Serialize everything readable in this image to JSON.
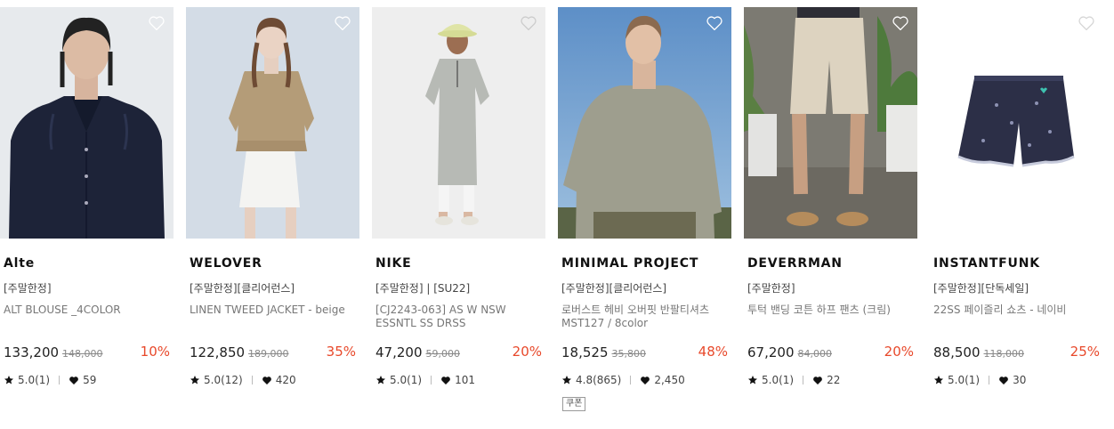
{
  "products": [
    {
      "brand": "Alte",
      "tag": "[주말한정]",
      "name": "ALT BLOUSE _4COLOR",
      "price": "133,200",
      "original_price": "148,000",
      "discount": "10%",
      "rating": "5.0(1)",
      "likes": "59"
    },
    {
      "brand": "WELOVER",
      "tag": "[주말한정][클리어런스]",
      "name": "LINEN TWEED JACKET - beige",
      "price": "122,850",
      "original_price": "189,000",
      "discount": "35%",
      "rating": "5.0(12)",
      "likes": "420"
    },
    {
      "brand": "NIKE",
      "tag": "[주말한정] | [SU22]",
      "name": "[CJ2243-063] AS W NSW ESSNTL SS DRSS",
      "price": "47,200",
      "original_price": "59,000",
      "discount": "20%",
      "rating": "5.0(1)",
      "likes": "101"
    },
    {
      "brand": "MINIMAL PROJECT",
      "tag": "[주말한정][클리어런스]",
      "name": "로버스트 헤비 오버핏 반팔티셔츠 MST127 / 8color",
      "price": "18,525",
      "original_price": "35,800",
      "discount": "48%",
      "rating": "4.8(865)",
      "likes": "2,450",
      "coupon": "쿠폰"
    },
    {
      "brand": "DEVERRMAN",
      "tag": "[주말한정]",
      "name": "투턱 밴딩 코튼 하프 팬츠 (크림)",
      "price": "67,200",
      "original_price": "84,000",
      "discount": "20%",
      "rating": "5.0(1)",
      "likes": "22"
    },
    {
      "brand": "INSTANTFUNK",
      "tag": "[주말한정][단독세일]",
      "name": "22SS 페이즐리 쇼츠 - 네이비",
      "price": "88,500",
      "original_price": "118,000",
      "discount": "25%",
      "rating": "5.0(1)",
      "likes": "30"
    }
  ],
  "colors": {
    "discount": "#e8492b",
    "text": "#222222",
    "muted": "#777777"
  },
  "icons": {
    "wishlist": "heart-outline-icon",
    "rating": "star-icon",
    "likes": "heart-filled-icon"
  }
}
